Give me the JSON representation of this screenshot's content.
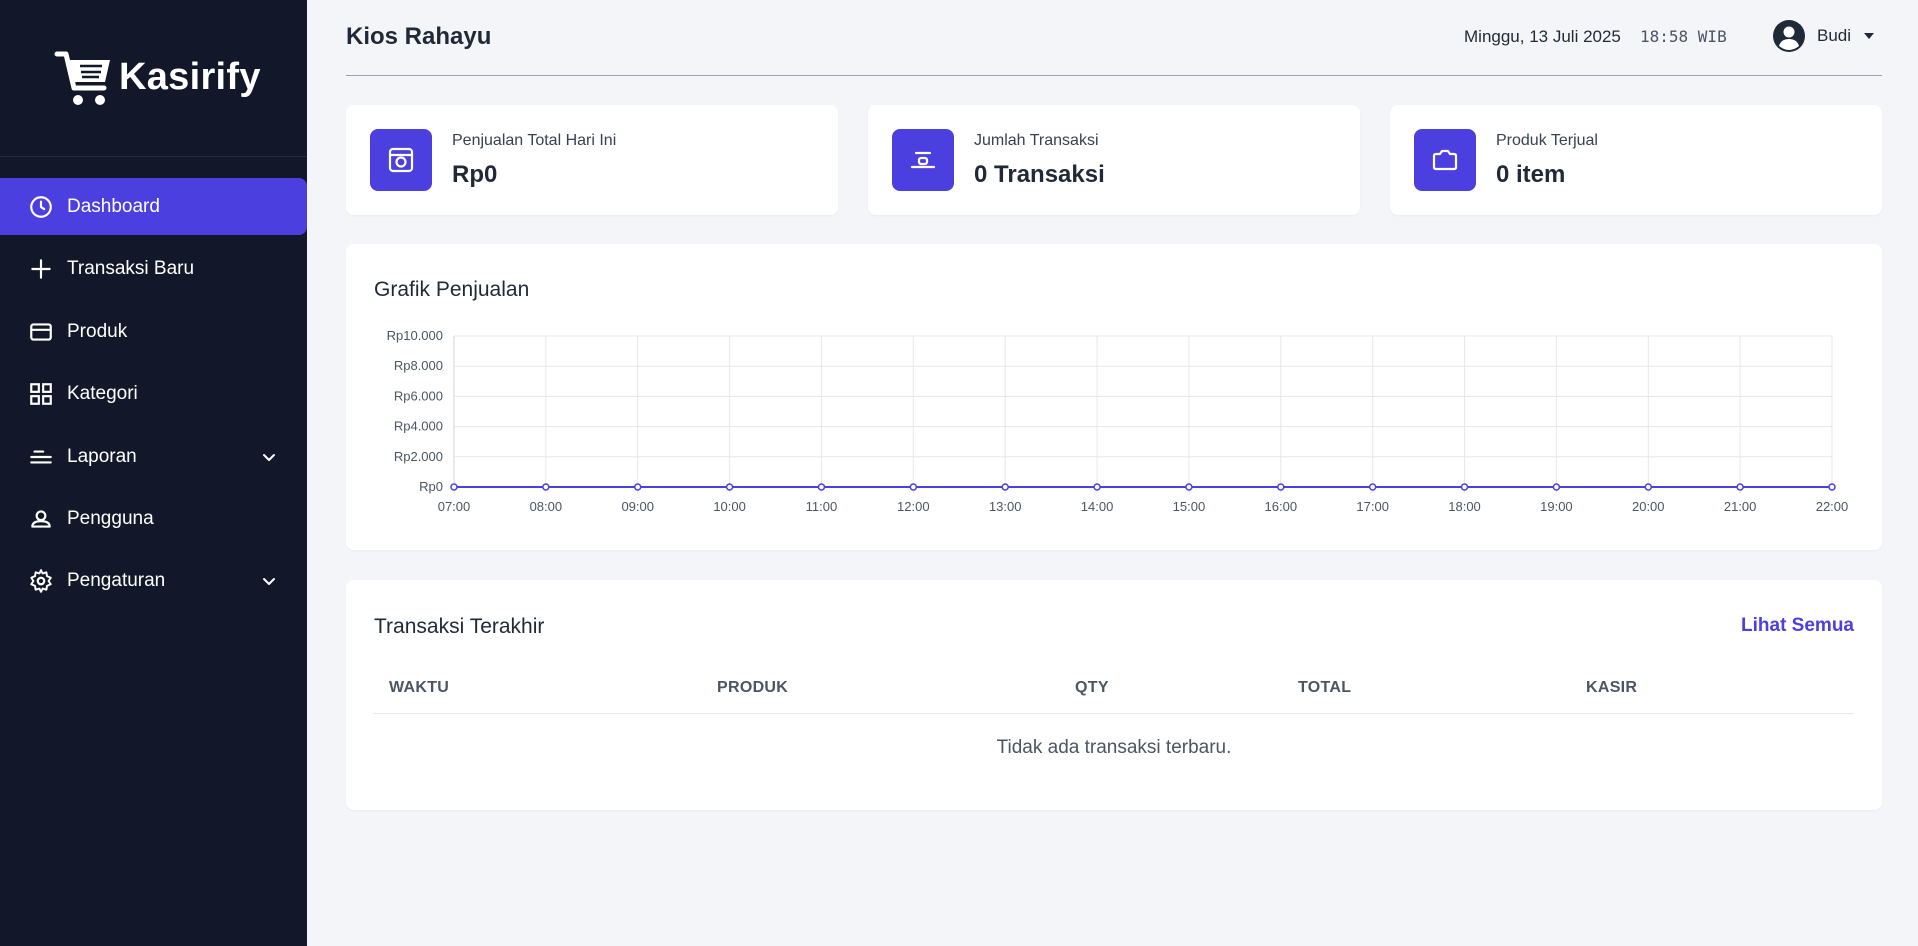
{
  "brand": {
    "name": "Kasirify",
    "icon": "shopping-cart-icon"
  },
  "sidebar": {
    "items": [
      {
        "label": "Dashboard",
        "icon": "clock-icon",
        "active": true
      },
      {
        "label": "Transaksi Baru",
        "icon": "plus-icon"
      },
      {
        "label": "Produk",
        "icon": "card-icon"
      },
      {
        "label": "Kategori",
        "icon": "grid-icon"
      },
      {
        "label": "Laporan",
        "icon": "lines-icon",
        "expandable": true
      },
      {
        "label": "Pengguna",
        "icon": "user-icon"
      },
      {
        "label": "Pengaturan",
        "icon": "gear-icon",
        "expandable": true
      }
    ]
  },
  "header": {
    "store_name": "Kios Rahayu",
    "date": "Minggu, 13 Juli 2025",
    "time": "18:58 WIB",
    "user": {
      "name": "Budi",
      "icon": "user-circle-icon"
    }
  },
  "stats": [
    {
      "label": "Penjualan Total Hari Ini",
      "value": "Rp0",
      "icon": "camera-icon"
    },
    {
      "label": "Jumlah Transaksi",
      "value": "0 Transaksi",
      "icon": "scale-icon"
    },
    {
      "label": "Produk Terjual",
      "value": "0 item",
      "icon": "bag-icon"
    }
  ],
  "chart_section": {
    "title": "Grafik Penjualan"
  },
  "chart_data": {
    "type": "line",
    "title": "Grafik Penjualan",
    "xlabel": "",
    "ylabel": "",
    "x": [
      "07:00",
      "08:00",
      "09:00",
      "10:00",
      "11:00",
      "12:00",
      "13:00",
      "14:00",
      "15:00",
      "16:00",
      "17:00",
      "18:00",
      "19:00",
      "20:00",
      "21:00",
      "22:00"
    ],
    "series": [
      {
        "values": [
          0,
          0,
          0,
          0,
          0,
          0,
          0,
          0,
          0,
          0,
          0,
          0,
          0,
          0,
          0,
          0
        ]
      }
    ],
    "ylim": [
      0,
      10000
    ],
    "yticks": [
      "Rp0",
      "Rp2.000",
      "Rp4.000",
      "Rp6.000",
      "Rp8.000",
      "Rp10.000"
    ],
    "grid": true,
    "line_color": "#4c3fe0"
  },
  "transactions": {
    "title": "Transaksi Terakhir",
    "see_all": "Lihat Semua",
    "columns": [
      "WAKTU",
      "PRODUK",
      "QTY",
      "TOTAL",
      "KASIR"
    ],
    "empty_message": "Tidak ada transaksi terbaru."
  },
  "colors": {
    "accent": "#4c3fe0",
    "sidebar_bg": "#121829",
    "page_bg": "#f4f5f8"
  }
}
